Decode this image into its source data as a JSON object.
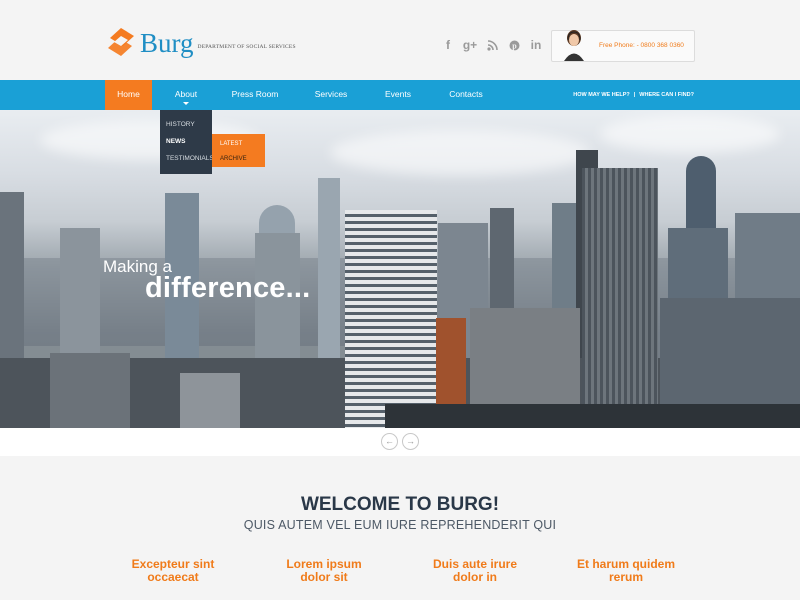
{
  "header": {
    "logo_name": "Burg",
    "logo_tagline": "DEPARTMENT OF SOCIAL SERVICES",
    "social_icons": [
      "facebook-icon",
      "google-plus-icon",
      "rss-icon",
      "pinterest-icon",
      "linkedin-icon"
    ],
    "phone_label": "Free Phone: - 0800 368 0360"
  },
  "nav": {
    "items": [
      {
        "label": "Home"
      },
      {
        "label": "About"
      },
      {
        "label": "Press Room"
      },
      {
        "label": "Services"
      },
      {
        "label": "Events"
      },
      {
        "label": "Contacts"
      }
    ],
    "right_links": [
      "HOW MAY WE HELP?",
      "WHERE CAN I FIND?"
    ],
    "about_menu": [
      "HISTORY",
      "NEWS",
      "TESTIMONIALS"
    ],
    "news_submenu": [
      "LATEST",
      "ARCHIVE"
    ]
  },
  "hero": {
    "line1": "Making a",
    "line2": "difference..."
  },
  "slider": {
    "prev": "←",
    "next": "→"
  },
  "welcome": {
    "title": "WELCOME TO BURG!",
    "subtitle": "QUIS AUTEM VEL EUM IURE REPREHENDERIT QUI"
  },
  "features": [
    {
      "title_line1": "Excepteur sint",
      "title_line2": "occaecat"
    },
    {
      "title_line1": "Lorem ipsum",
      "title_line2": "dolor sit"
    },
    {
      "title_line1": "Duis aute irure",
      "title_line2": "dolor in"
    },
    {
      "title_line1": "Et harum quidem",
      "title_line2": "rerum"
    }
  ],
  "colors": {
    "accent_orange": "#f47b20",
    "nav_blue": "#1aa0d6",
    "logo_blue": "#1f8ec4",
    "dark_text": "#2a3848"
  }
}
